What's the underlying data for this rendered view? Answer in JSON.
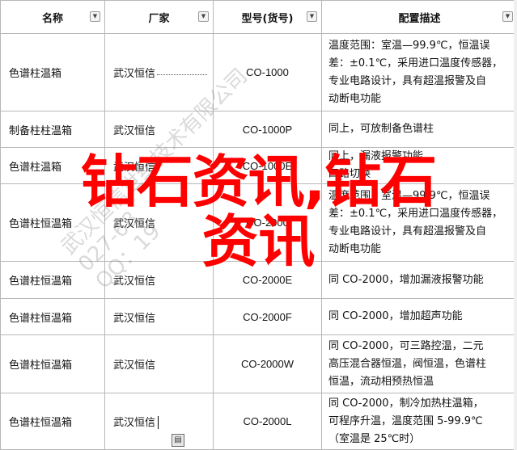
{
  "headers": {
    "name": "名称",
    "maker": "厂家",
    "model": "型号(货号)",
    "desc": "配置描述"
  },
  "rows": [
    {
      "name": "色谱柱温箱",
      "maker": "武汉恒信",
      "model": "CO-1000",
      "desc": [
        "温度范围：室温—99.9℃，恒温误",
        "差：±0.1℃，采用进口温度传感器，",
        "专业电路设计，具有超温报警及自",
        "动断电功能"
      ]
    },
    {
      "name": "制备柱柱温箱",
      "maker": "武汉恒信",
      "model": "CO-1000P",
      "desc": [
        "同上，可放制备色谱柱"
      ]
    },
    {
      "name": "色谱柱温箱",
      "maker": "武汉恒信",
      "model": "CO-1000E",
      "desc": [
        "同上，漏液报警功能",
        "四路切换"
      ]
    },
    {
      "name": "色谱柱恒温箱",
      "maker": "武汉恒信",
      "model": "CO-2000",
      "desc": [
        "温度范围：室温—99.9℃，恒温误",
        "差：±0.1℃，采用进口温度传感器，",
        "专业电路设计，具有超温报警及自",
        "动断电功能"
      ]
    },
    {
      "name": "色谱柱恒温箱",
      "maker": "武汉恒信",
      "model": "CO-2000E",
      "desc": [
        "同 CO-2000，增加漏液报警功能"
      ]
    },
    {
      "name": "色谱柱恒温箱",
      "maker": "武汉恒信",
      "model": "CO-2000F",
      "desc": [
        "同 CO-2000，增加超声功能"
      ]
    },
    {
      "name": "色谱柱恒温箱",
      "maker": "武汉恒信",
      "model": "CO-2000W",
      "desc": [
        "同 CO-2000，可三路控温，二元",
        "高压混合器恒温，阀恒温，色谱柱",
        "恒温，流动相预热恒温"
      ]
    },
    {
      "name": "色谱柱恒温箱",
      "maker": "武汉恒信",
      "model": "CO-2000L",
      "desc": [
        "同 CO-2000，制冷加热柱温箱，",
        "可程序升温，温度范围 5-99.9℃",
        "（室温是 25℃时）"
      ]
    }
  ],
  "watermark": {
    "big_line1": "钻石资讯,钻石",
    "big_line2": "资讯",
    "diag_line1": "武汉恒信世纪技术有限公司",
    "diag_line2": "027-68",
    "diag_line3": "QQ：19"
  }
}
